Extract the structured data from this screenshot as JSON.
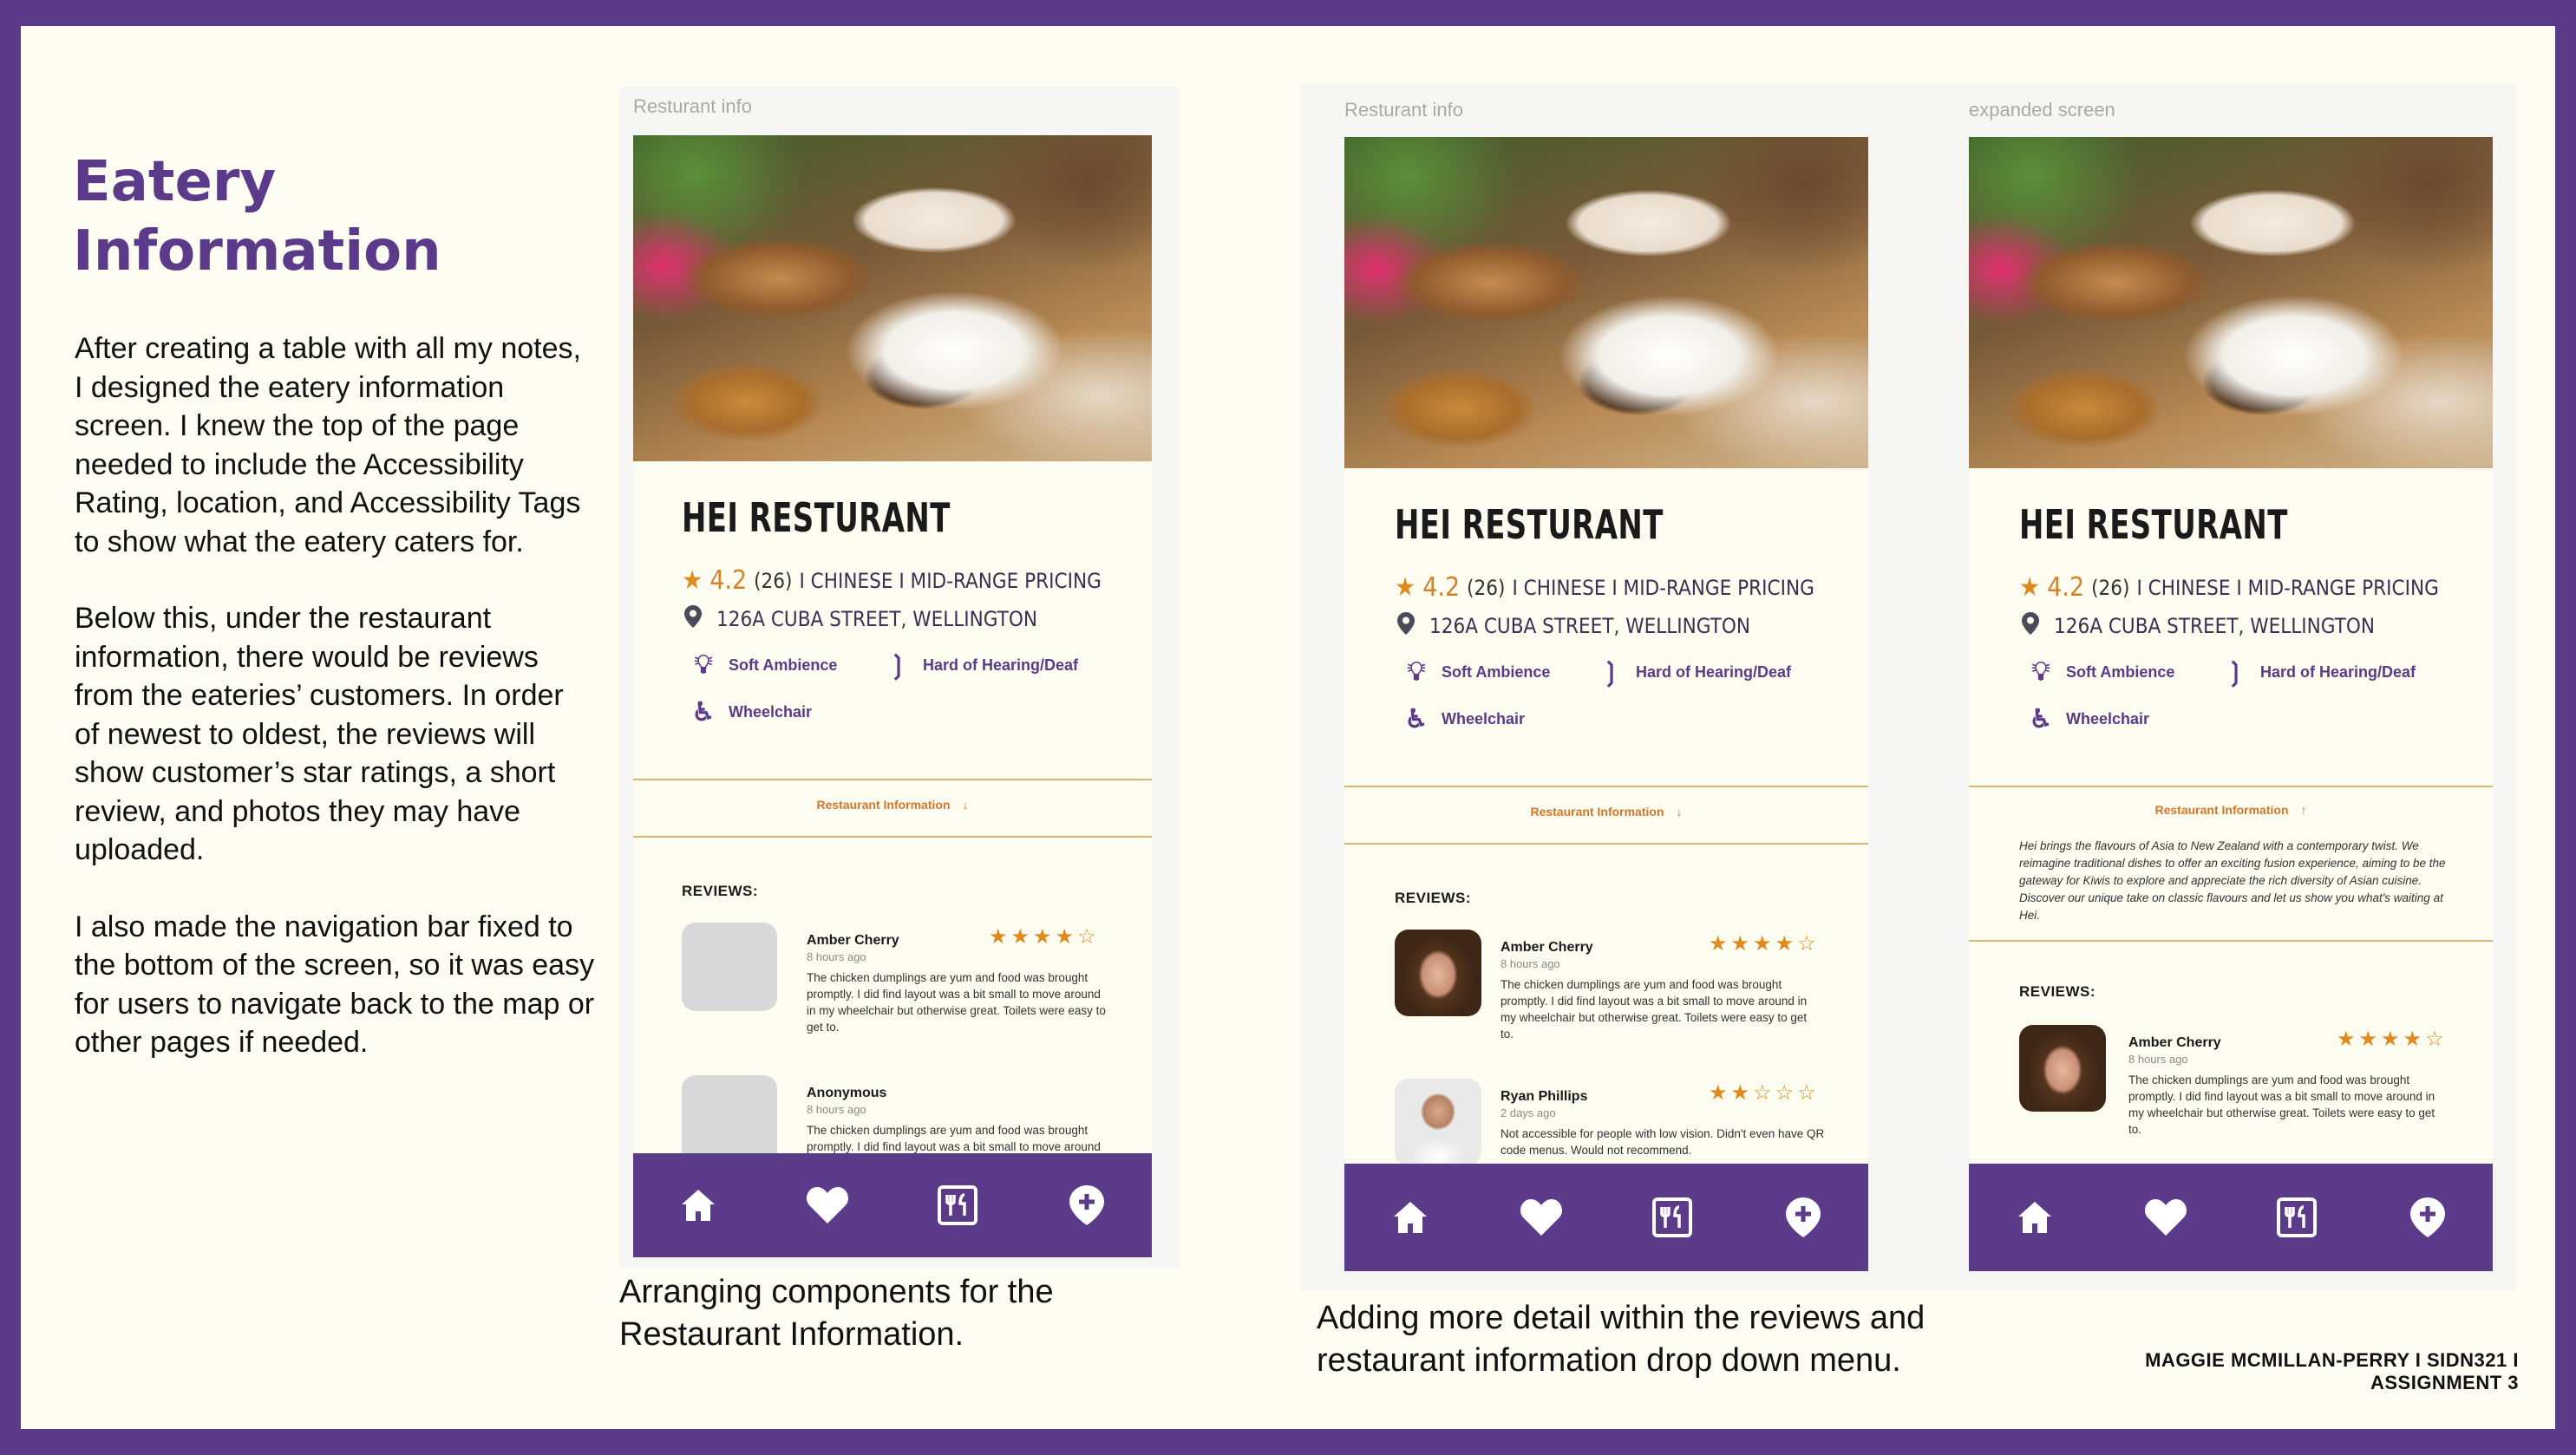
{
  "heading": "Eatery Information",
  "body_paragraphs": [
    "After creating a table with all my notes, I designed the eatery information screen. I knew the top of the page needed to include the Accessibility Rating, location, and Accessibility Tags to show what the eatery caters for.",
    "Below this, under the restaurant information, there would be reviews from the eateries’ customers. In order of  newest to oldest, the reviews will show customer’s star ratings, a short review, and photos they may have uploaded.",
    "I also made the navigation bar fixed to the bottom of the screen, so it was easy for users to navigate back to the map or other pages if needed."
  ],
  "captions": {
    "first": [
      "Arranging components for the",
      "Restaurant Information."
    ],
    "second": [
      "Adding more detail within the reviews and",
      "restaurant information drop down menu."
    ]
  },
  "footer": "MAGGIE MCMILLAN-PERRY I SIDN321 I ASSIGNMENT 3",
  "frame_labels": [
    "Resturant info",
    "Resturant info",
    "expanded screen"
  ],
  "restaurant": {
    "name": "HEI RESTURANT",
    "rating": "4.2",
    "review_count": "(26)",
    "details": "I CHINESE I MID-RANGE PRICING",
    "address": "126A CUBA STREET, WELLINGTON",
    "tags": [
      "Soft Ambience",
      "Hard of Hearing/Deaf",
      "Wheelchair"
    ],
    "info_label": "Restaurant Information",
    "description": "Hei brings the flavours of Asia to New Zealand with a contemporary twist. We reimagine traditional dishes to offer an exciting fusion experience, aiming to be the gateway for Kiwis to explore and appreciate the rich diversity of Asian cuisine. Discover our unique take on classic flavours and let us show you what's waiting at Hei."
  },
  "reviews_heading": "REVIEWS:",
  "reviews": [
    {
      "name": "Amber Cherry",
      "time": "8 hours ago",
      "stars": "★★★★☆",
      "text": "The chicken dumplings are yum and food was brought promptly. I did find layout was a bit small to move around in my wheelchair but otherwise great. Toilets were easy to get to."
    },
    {
      "name": "Anonymous",
      "time": "8 hours ago",
      "text": "The chicken dumplings are yum and food was brought promptly. I did find layout was a bit small to move around in my wheelchair but otherwise great. Toilets were easy to get to."
    },
    {
      "name": "Ryan Phillips",
      "time": "2 days ago",
      "stars": "★★☆☆☆",
      "text": "Not accessible for people with low vision. Didn't even have QR code menus. Would not recommend."
    }
  ],
  "nav_items": [
    "home-icon",
    "heart-icon",
    "menu-icon",
    "add-location-icon"
  ],
  "colors": {
    "brand": "#5b3a8a",
    "accent": "#e08a1e",
    "background": "#fdfcf3"
  }
}
